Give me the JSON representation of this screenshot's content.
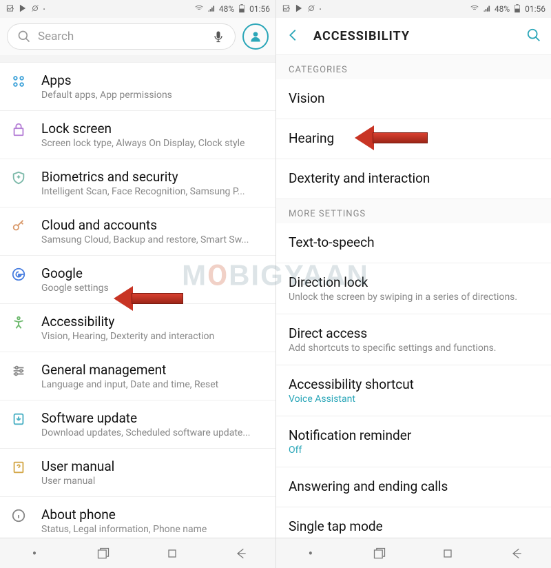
{
  "statusbar": {
    "battery": "48%",
    "time": "01:56"
  },
  "left": {
    "search": {
      "placeholder": "Search"
    },
    "items": [
      {
        "title": "Apps",
        "sub": "Default apps, App permissions",
        "ic": "apps"
      },
      {
        "title": "Lock screen",
        "sub": "Screen lock type, Always On Display, Clock style",
        "ic": "lock"
      },
      {
        "title": "Biometrics and security",
        "sub": "Intelligent Scan, Face Recognition, Samsung P...",
        "ic": "shield"
      },
      {
        "title": "Cloud and accounts",
        "sub": "Samsung Cloud, Backup and restore, Smart Sw...",
        "ic": "key"
      },
      {
        "title": "Google",
        "sub": "Google settings",
        "ic": "google"
      },
      {
        "title": "Accessibility",
        "sub": "Vision, Hearing, Dexterity and interaction",
        "ic": "a11y"
      },
      {
        "title": "General management",
        "sub": "Language and input, Date and time, Reset",
        "ic": "sliders"
      },
      {
        "title": "Software update",
        "sub": "Download updates, Scheduled software update...",
        "ic": "update"
      },
      {
        "title": "User manual",
        "sub": "User manual",
        "ic": "manual"
      },
      {
        "title": "About phone",
        "sub": "Status, Legal information, Phone name",
        "ic": "info"
      }
    ]
  },
  "right": {
    "title": "ACCESSIBILITY",
    "section1": "CATEGORIES",
    "section2": "MORE SETTINGS",
    "items1": [
      {
        "title": "Vision"
      },
      {
        "title": "Hearing"
      },
      {
        "title": "Dexterity and interaction"
      }
    ],
    "items2": [
      {
        "title": "Text-to-speech"
      },
      {
        "title": "Direction lock",
        "sub": "Unlock the screen by swiping in a series of directions."
      },
      {
        "title": "Direct access",
        "sub": "Add shortcuts to specific settings and functions."
      },
      {
        "title": "Accessibility shortcut",
        "sub": "Voice Assistant",
        "teal": true
      },
      {
        "title": "Notification reminder",
        "sub": "Off",
        "teal": true
      },
      {
        "title": "Answering and ending calls"
      },
      {
        "title": "Single tap mode"
      }
    ]
  },
  "watermark": "MOBIGYAAN"
}
